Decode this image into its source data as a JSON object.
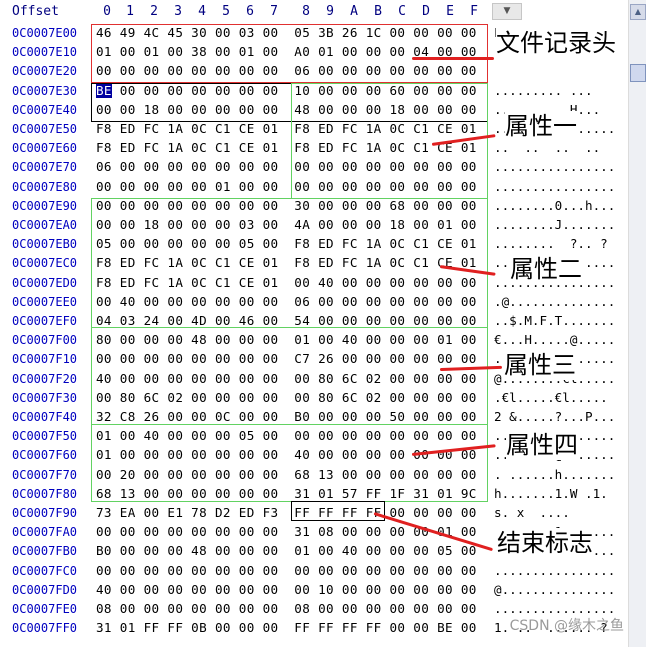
{
  "header": {
    "offset_label": "Offset",
    "columns": [
      "0",
      "1",
      "2",
      "3",
      "4",
      "5",
      "6",
      "7",
      "8",
      "9",
      "A",
      "B",
      "C",
      "D",
      "E",
      "F"
    ],
    "dropdown_icon": "chevron-down"
  },
  "rows": [
    {
      "addr": "0C0007E00",
      "hex": "46 49 4C 45 30 00 03 00  05 3B 26 1C 00 00 00 00",
      "ascii": "FILE0..."
    },
    {
      "addr": "0C0007E10",
      "hex": "01 00 01 00 38 00 01 00  A0 01 00 00 00 04 00 00",
      "ascii": "....8..."
    },
    {
      "addr": "0C0007E20",
      "hex": "00 00 00 00 00 00 00 00  06 00 00 00 00 00 00 00",
      "ascii": "........"
    },
    {
      "addr": "0C0007E30",
      "hex": "BE 00 00 00 00 00 00 00  10 00 00 00 60 00 00 00",
      "ascii": ".........`..."
    },
    {
      "addr": "0C0007E40",
      "hex": "00 00 18 00 00 00 00 00  48 00 00 00 18 00 00 00",
      "ascii": "..........H..."
    },
    {
      "addr": "0C0007E50",
      "hex": "F8 ED FC 1A 0C C1 CE 01  F8 ED FC 1A 0C C1 CE 01",
      "ascii": "................"
    },
    {
      "addr": "0C0007E60",
      "hex": "F8 ED FC 1A 0C C1 CE 01  F8 ED FC 1A 0C C1 CE 01",
      "ascii": "..  ..  ..  .."
    },
    {
      "addr": "0C0007E70",
      "hex": "06 00 00 00 00 00 00 00  00 00 00 00 00 00 00 00",
      "ascii": "................"
    },
    {
      "addr": "0C0007E80",
      "hex": "00 00 00 00 00 01 00 00  00 00 00 00 00 00 00 00",
      "ascii": "................"
    },
    {
      "addr": "0C0007E90",
      "hex": "00 00 00 00 00 00 00 00  30 00 00 00 68 00 00 00",
      "ascii": "........0...h..."
    },
    {
      "addr": "0C0007EA0",
      "hex": "00 00 18 00 00 00 03 00  4A 00 00 00 18 00 01 00",
      "ascii": "........J......."
    },
    {
      "addr": "0C0007EB0",
      "hex": "05 00 00 00 00 00 05 00  F8 ED FC 1A 0C C1 CE 01",
      "ascii": "........  ?.. ?"
    },
    {
      "addr": "0C0007EC0",
      "hex": "F8 ED FC 1A 0C C1 CE 01  F8 ED FC 1A 0C C1 CE 01",
      "ascii": "................"
    },
    {
      "addr": "0C0007ED0",
      "hex": "F8 ED FC 1A 0C C1 CE 01  00 40 00 00 00 00 00 00",
      "ascii": "................"
    },
    {
      "addr": "0C0007EE0",
      "hex": "00 40 00 00 00 00 00 00  06 00 00 00 00 00 00 00",
      "ascii": ".@.............."
    },
    {
      "addr": "0C0007EF0",
      "hex": "04 03 24 00 4D 00 46 00  54 00 00 00 00 00 00 00",
      "ascii": "..$.M.F.T......."
    },
    {
      "addr": "0C0007F00",
      "hex": "80 00 00 00 48 00 00 00  01 00 40 00 00 00 01 00",
      "ascii": "€...H.....@....."
    },
    {
      "addr": "0C0007F10",
      "hex": "00 00 00 00 00 00 00 00  C7 26 00 00 00 00 00 00",
      "ascii": "........?&......"
    },
    {
      "addr": "0C0007F20",
      "hex": "40 00 00 00 00 00 00 00  00 80 6C 02 00 00 00 00",
      "ascii": "@........€l....."
    },
    {
      "addr": "0C0007F30",
      "hex": "00 80 6C 02 00 00 00 00  00 80 6C 02 00 00 00 00",
      "ascii": ".€l.....€l....."
    },
    {
      "addr": "0C0007F40",
      "hex": "32 C8 26 00 00 0C 00 00  B0 00 00 00 50 00 00 00",
      "ascii": "2 &.....?...P..."
    },
    {
      "addr": "0C0007F50",
      "hex": "01 00 40 00 00 00 05 00  00 00 00 00 00 00 00 00",
      "ascii": "..@............."
    },
    {
      "addr": "0C0007F60",
      "hex": "01 00 00 00 00 00 00 00  40 00 00 00 00 00 00 00",
      "ascii": "........@......."
    },
    {
      "addr": "0C0007F70",
      "hex": "00 20 00 00 00 00 00 00  68 13 00 00 00 00 00 00",
      "ascii": ". ......h......."
    },
    {
      "addr": "0C0007F80",
      "hex": "68 13 00 00 00 00 00 00  31 01 57 FF 1F 31 01 9C",
      "ascii": "h.......1.W .1."
    },
    {
      "addr": "0C0007F90",
      "hex": "73 EA 00 E1 78 D2 ED F3  FF FF FF FF 00 00 00 00",
      "ascii": "s. x  ...."
    },
    {
      "addr": "0C0007FA0",
      "hex": "00 00 00 00 00 00 00 00  31 08 00 00 00 00 01 00",
      "ascii": "........1......."
    },
    {
      "addr": "0C0007FB0",
      "hex": "B0 00 00 00 48 00 00 00  01 00 40 00 00 00 05 00",
      "ascii": "....H.....@....."
    },
    {
      "addr": "0C0007FC0",
      "hex": "00 00 00 00 00 00 00 00  00 00 00 00 00 00 00 00",
      "ascii": "................"
    },
    {
      "addr": "0C0007FD0",
      "hex": "40 00 00 00 00 00 00 00  00 10 00 00 00 00 00 00",
      "ascii": "@..............."
    },
    {
      "addr": "0C0007FE0",
      "hex": "08 00 00 00 00 00 00 00  08 00 00 00 00 00 00 00",
      "ascii": "................"
    },
    {
      "addr": "0C0007FF0",
      "hex": "31 01 FF FF 0B 00 00 00  FF FF FF FF 00 00 BE 00",
      "ascii": "1. ..  ...... ?"
    }
  ],
  "annotations": [
    {
      "text": "文件记录头"
    },
    {
      "text": "属性一"
    },
    {
      "text": "属性二"
    },
    {
      "text": "属性三"
    },
    {
      "text": "属性四"
    },
    {
      "text": "结束标志"
    }
  ],
  "watermark": "CSDN @缘木之鱼",
  "colors": {
    "address": "#0000c0",
    "header": "#000080",
    "red_box": "#e03030",
    "green_box": "#62d262",
    "arrow": "#e02020",
    "selection": "#0000a0"
  }
}
